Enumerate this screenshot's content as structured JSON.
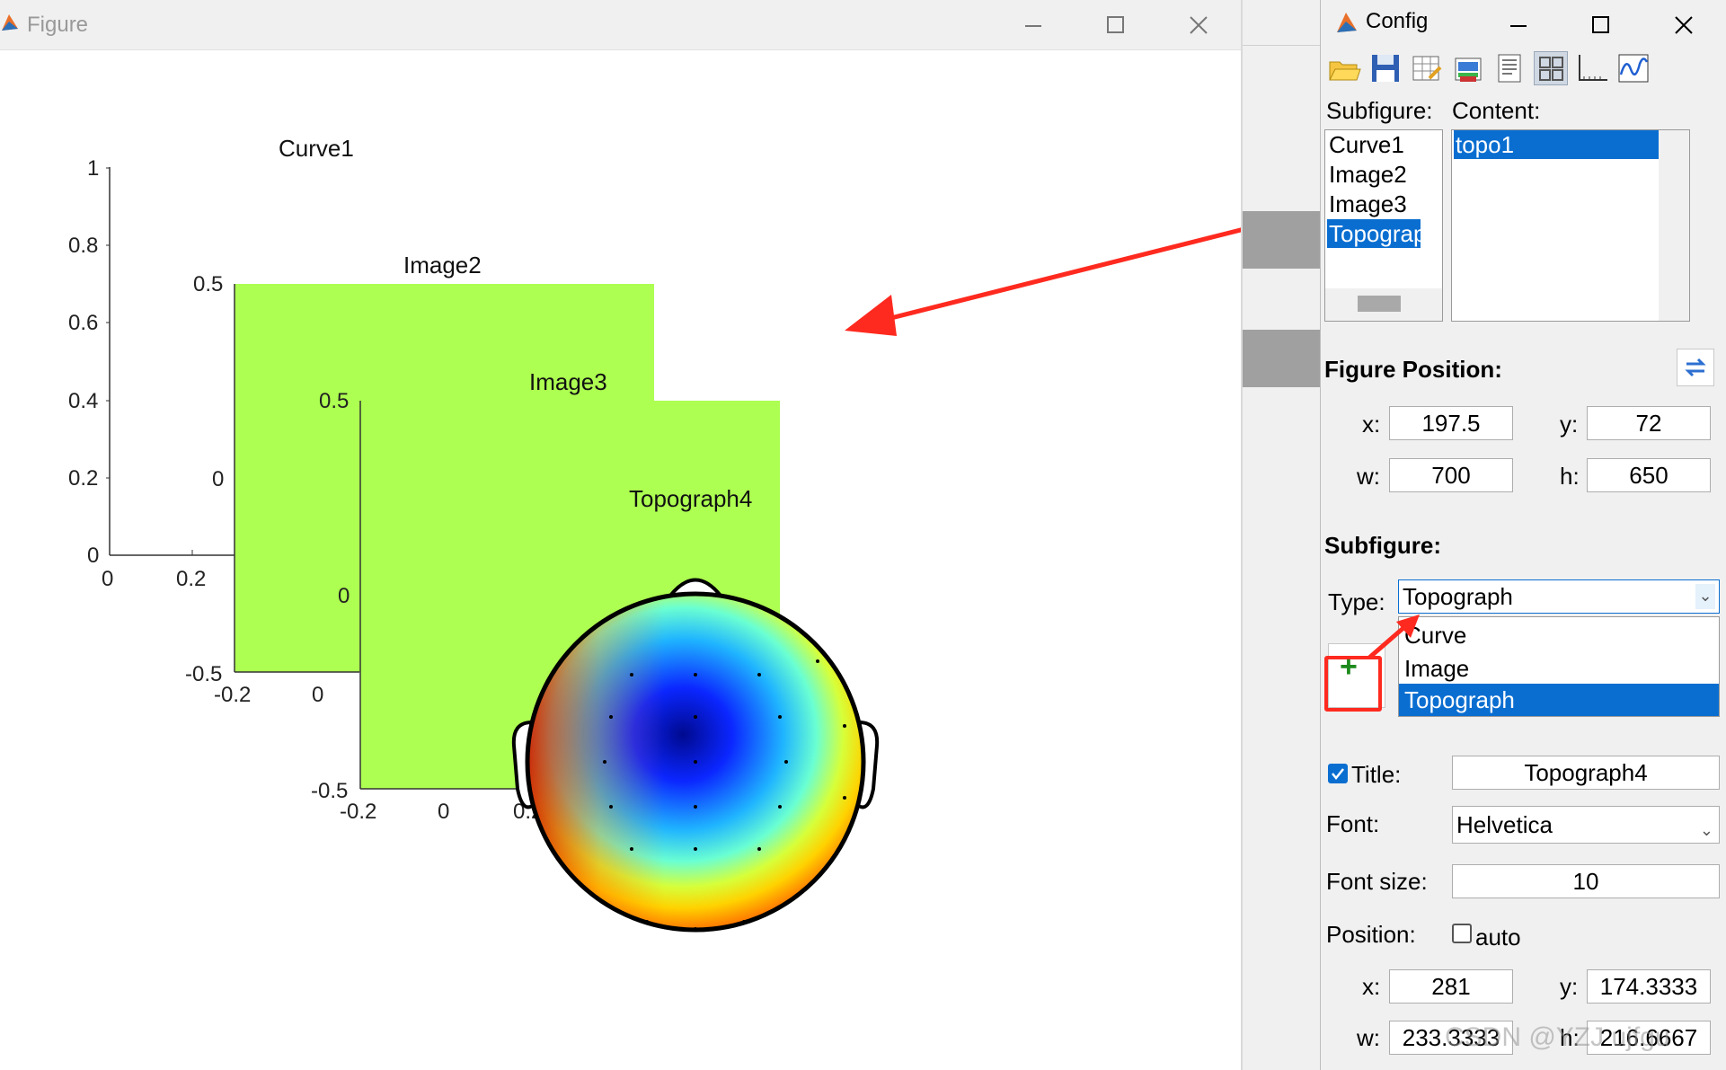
{
  "figure_window": {
    "title": "Figure",
    "subplots": {
      "curve": {
        "title": "Curve1",
        "yticks": [
          "1",
          "0.8",
          "0.6",
          "0.4",
          "0.2",
          "0"
        ],
        "xticks": [
          "0",
          "0.2"
        ]
      },
      "image2": {
        "title": "Image2",
        "yticks": [
          "0.5",
          "0",
          "-0.5"
        ],
        "xticks": [
          "-0.2",
          "0"
        ],
        "fill": "#adff51"
      },
      "image3": {
        "title": "Image3",
        "yticks": [
          "0.5",
          "0",
          "-0.5"
        ],
        "xticks": [
          "-0.2",
          "0",
          "0.2"
        ],
        "fill": "#adff51"
      },
      "topo": {
        "title": "Topograph4"
      }
    }
  },
  "config_window": {
    "title": "Config",
    "toolbar": [
      "open-icon",
      "save-icon",
      "table-icon",
      "print-icon",
      "text-icon",
      "grid-layout-icon",
      "axes-icon",
      "waveform-icon"
    ],
    "subfigure_label": "Subfigure:",
    "content_label": "Content:",
    "subfigure_items": [
      "Curve1",
      "Image2",
      "Image3",
      "Topograph"
    ],
    "subfigure_selected": "Topograph",
    "content_items": [
      "topo1"
    ],
    "figure_position": {
      "heading": "Figure Position:",
      "x_label": "x:",
      "x": "197.5",
      "y_label": "y:",
      "y": "72",
      "w_label": "w:",
      "w": "700",
      "h_label": "h:",
      "h": "650"
    },
    "subfigure_section": {
      "heading": "Subfigure:",
      "type_label": "Type:",
      "type_value": "Topograph",
      "type_options": [
        "Curve",
        "Image",
        "Topograph"
      ],
      "add_glyph": "+",
      "title_label": "Title:",
      "title_value": "Topograph4",
      "title_checked": true,
      "font_label": "Font:",
      "font_value": "Helvetica",
      "font_size_label": "Font size:",
      "font_size_value": "10",
      "position_label": "Position:",
      "auto_label": "auto",
      "x_label": "x:",
      "x": "281",
      "y_label": "y:",
      "y": "174.3333",
      "w_label": "w:",
      "w": "233.3333",
      "h_label": "h:",
      "h": "216.6667"
    },
    "watermark": "CSDN @YZJ ujfgu"
  },
  "colors": {
    "selection": "#0a6ed1",
    "image_fill": "#adff51",
    "annotation": "#ff2a1f"
  }
}
